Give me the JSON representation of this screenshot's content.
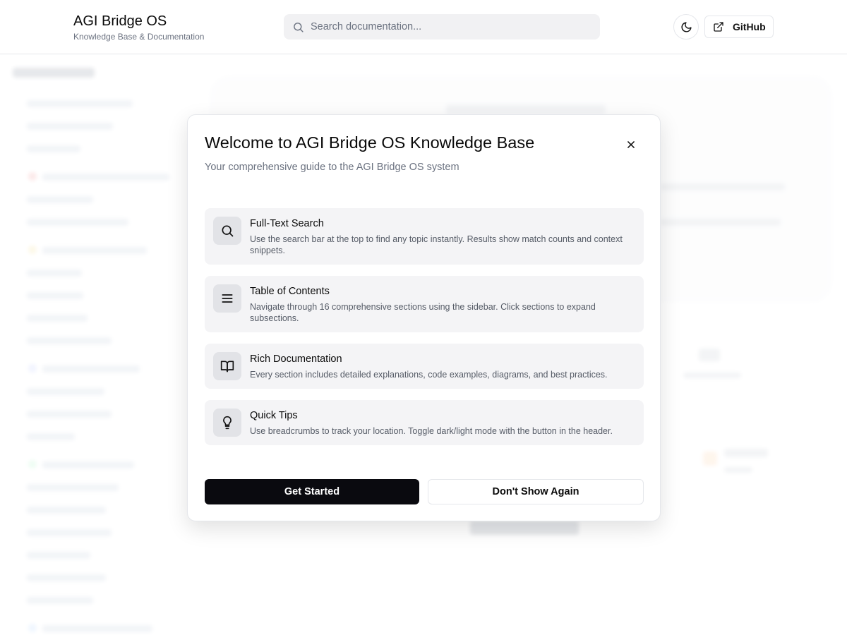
{
  "header": {
    "title": "AGI Bridge OS",
    "subtitle": "Knowledge Base & Documentation",
    "search_placeholder": "Search documentation...",
    "theme_icon": "moon-icon",
    "github_label": "GitHub",
    "github_icon": "external-link-icon"
  },
  "modal": {
    "title": "Welcome to AGI Bridge OS Knowledge Base",
    "subtitle": "Your comprehensive guide to the AGI Bridge OS system",
    "features": [
      {
        "icon": "search-icon",
        "title": "Full-Text Search",
        "description": "Use the search bar at the top to find any topic instantly. Results show match counts and context snippets."
      },
      {
        "icon": "list-icon",
        "title": "Table of Contents",
        "description": "Navigate through 16 comprehensive sections using the sidebar. Click sections to expand subsections."
      },
      {
        "icon": "book-open-icon",
        "title": "Rich Documentation",
        "description": "Every section includes detailed explanations, code examples, diagrams, and best practices."
      },
      {
        "icon": "lightbulb-icon",
        "title": "Quick Tips",
        "description": "Use breadcrumbs to track your location. Toggle dark/light mode with the button in the header."
      }
    ],
    "primary_button": "Get Started",
    "secondary_button": "Don't Show Again"
  },
  "colors": {
    "primary": "#0a0a0f",
    "feature_bg": "#f4f4f6",
    "muted_text": "#6b7280"
  }
}
